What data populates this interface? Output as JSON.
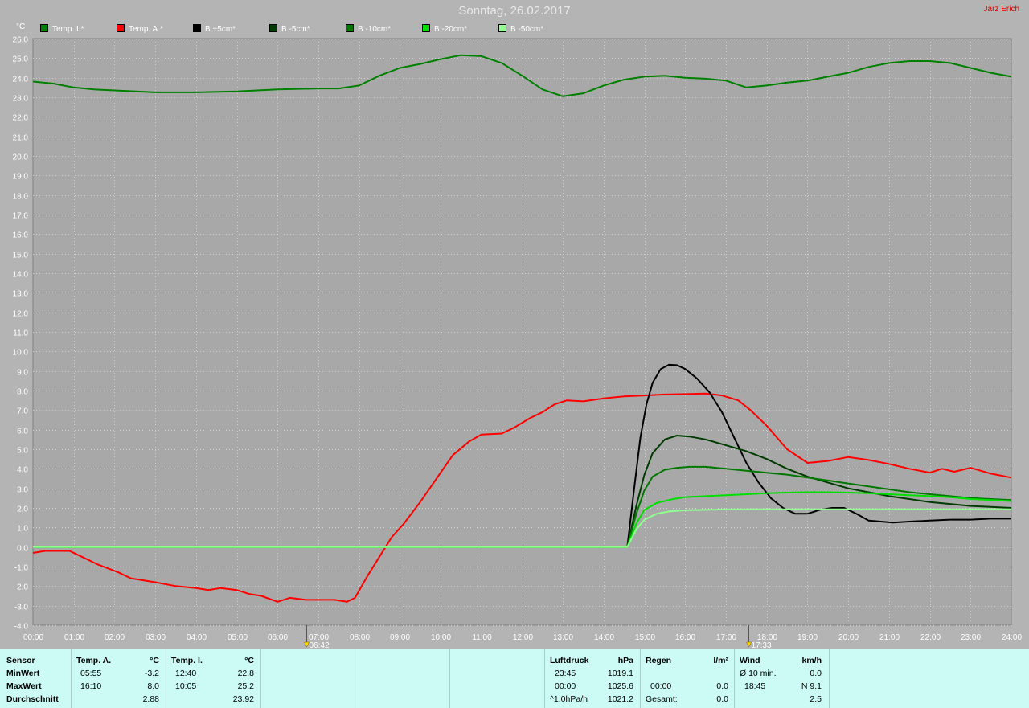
{
  "header": {
    "title": "Sonntag, 26.02.2017",
    "author": "Jarz Erich"
  },
  "legend": [
    {
      "label": "Temp. I.*",
      "color": "#008000"
    },
    {
      "label": "Temp. A.*",
      "color": "#ff0000"
    },
    {
      "label": "B +5cm*",
      "color": "#000000"
    },
    {
      "label": "B -5cm*",
      "color": "#003c00"
    },
    {
      "label": "B -10cm*",
      "color": "#007800"
    },
    {
      "label": "B -20cm*",
      "color": "#00e000"
    },
    {
      "label": "B -50cm*",
      "color": "#90ff90"
    }
  ],
  "chart_data": {
    "type": "line",
    "ylabel": "°C",
    "ylim": [
      -4,
      26
    ],
    "ystep": 1,
    "xlim": [
      0,
      24
    ],
    "xticks": [
      "00:00",
      "01:00",
      "02:00",
      "03:00",
      "04:00",
      "05:00",
      "06:00",
      "07:00",
      "08:00",
      "09:00",
      "10:00",
      "11:00",
      "12:00",
      "13:00",
      "14:00",
      "15:00",
      "16:00",
      "17:00",
      "18:00",
      "19:00",
      "20:00",
      "21:00",
      "22:00",
      "23:00",
      "24:00"
    ],
    "grid": true,
    "sun_markers": [
      {
        "label": "06:42",
        "hour": 6.7,
        "kind": "sunrise"
      },
      {
        "label": "17:33",
        "hour": 17.55,
        "kind": "sunset"
      }
    ],
    "series": [
      {
        "name": "Temp. I.*",
        "color": "#008000",
        "x": [
          0,
          0.5,
          1,
          1.5,
          2,
          3,
          4,
          5,
          6,
          7,
          7.5,
          8,
          8.5,
          9,
          9.5,
          10,
          10.5,
          11,
          11.5,
          12,
          12.5,
          13,
          13.5,
          14,
          14.5,
          15,
          15.5,
          16,
          16.5,
          17,
          17.5,
          18,
          18.5,
          19,
          19.5,
          20,
          20.5,
          21,
          21.5,
          22,
          22.5,
          23,
          23.5,
          24
        ],
        "y": [
          23.8,
          23.7,
          23.5,
          23.4,
          23.35,
          23.25,
          23.25,
          23.3,
          23.4,
          23.45,
          23.45,
          23.6,
          24.1,
          24.5,
          24.7,
          24.95,
          25.15,
          25.1,
          24.75,
          24.1,
          23.4,
          23.05,
          23.2,
          23.6,
          23.9,
          24.05,
          24.1,
          24,
          23.95,
          23.85,
          23.5,
          23.6,
          23.75,
          23.85,
          24.05,
          24.25,
          24.55,
          24.75,
          24.85,
          24.85,
          24.75,
          24.5,
          24.25,
          24.05
        ]
      },
      {
        "name": "Temp. A.*",
        "color": "#ff0000",
        "x": [
          0,
          0.3,
          0.9,
          1.2,
          1.6,
          2.1,
          2.4,
          3,
          3.5,
          4,
          4.3,
          4.6,
          5,
          5.3,
          5.6,
          6,
          6.3,
          6.7,
          7,
          7.4,
          7.7,
          7.9,
          8.2,
          8.5,
          8.8,
          9.1,
          9.5,
          9.9,
          10.3,
          10.7,
          11,
          11.5,
          11.8,
          12.2,
          12.5,
          12.8,
          13.1,
          13.5,
          14,
          14.5,
          15,
          15.5,
          16,
          16.5,
          16.9,
          17.3,
          17.6,
          18,
          18.5,
          19,
          19.5,
          20,
          20.5,
          21,
          21.5,
          22,
          22.3,
          22.6,
          23,
          23.5,
          24
        ],
        "y": [
          -0.3,
          -0.2,
          -0.2,
          -0.5,
          -0.9,
          -1.3,
          -1.6,
          -1.8,
          -2,
          -2.1,
          -2.2,
          -2.1,
          -2.2,
          -2.4,
          -2.5,
          -2.8,
          -2.6,
          -2.7,
          -2.7,
          -2.7,
          -2.8,
          -2.6,
          -1.5,
          -0.5,
          0.5,
          1.2,
          2.3,
          3.5,
          4.7,
          5.4,
          5.75,
          5.8,
          6.1,
          6.6,
          6.9,
          7.3,
          7.5,
          7.45,
          7.6,
          7.7,
          7.75,
          7.8,
          7.82,
          7.85,
          7.75,
          7.5,
          7,
          6.2,
          5.0,
          4.3,
          4.4,
          4.6,
          4.45,
          4.25,
          4.0,
          3.8,
          4.0,
          3.85,
          4.05,
          3.75,
          3.55
        ]
      },
      {
        "name": "B +5cm*",
        "color": "#000000",
        "x": [
          0,
          14.58,
          14.75,
          14.9,
          15.05,
          15.2,
          15.4,
          15.6,
          15.8,
          16,
          16.3,
          16.6,
          16.9,
          17.2,
          17.5,
          17.8,
          18.1,
          18.4,
          18.7,
          19,
          19.3,
          19.6,
          19.9,
          20.2,
          20.5,
          20.8,
          21.1,
          21.5,
          22,
          22.5,
          23,
          23.5,
          24
        ],
        "y": [
          0,
          0,
          3.0,
          5.6,
          7.3,
          8.4,
          9.1,
          9.32,
          9.3,
          9.1,
          8.6,
          7.9,
          6.9,
          5.6,
          4.3,
          3.3,
          2.5,
          2.0,
          1.7,
          1.7,
          1.9,
          2.0,
          2.0,
          1.7,
          1.35,
          1.3,
          1.25,
          1.3,
          1.35,
          1.4,
          1.4,
          1.45,
          1.45
        ]
      },
      {
        "name": "B -5cm*",
        "color": "#003c00",
        "x": [
          0,
          14.58,
          14.8,
          15,
          15.2,
          15.5,
          15.8,
          16.1,
          16.5,
          17,
          17.5,
          18,
          18.5,
          19,
          19.5,
          20,
          20.5,
          21,
          21.5,
          22,
          22.5,
          23,
          23.5,
          24
        ],
        "y": [
          0,
          0,
          2.1,
          3.7,
          4.8,
          5.5,
          5.7,
          5.65,
          5.5,
          5.2,
          4.9,
          4.5,
          4.0,
          3.6,
          3.3,
          3.0,
          2.8,
          2.6,
          2.45,
          2.3,
          2.2,
          2.1,
          2.05,
          2.0
        ]
      },
      {
        "name": "B -10cm*",
        "color": "#007800",
        "x": [
          0,
          14.58,
          14.8,
          15,
          15.2,
          15.5,
          15.8,
          16.1,
          16.5,
          17,
          17.5,
          18,
          18.5,
          19,
          19.5,
          20,
          20.5,
          21,
          21.5,
          22,
          22.5,
          23,
          23.5,
          24
        ],
        "y": [
          0,
          0,
          1.7,
          2.9,
          3.6,
          3.95,
          4.05,
          4.1,
          4.1,
          4.0,
          3.9,
          3.8,
          3.7,
          3.55,
          3.4,
          3.25,
          3.1,
          2.95,
          2.8,
          2.7,
          2.6,
          2.5,
          2.45,
          2.4
        ]
      },
      {
        "name": "B -20cm*",
        "color": "#00e000",
        "x": [
          0,
          14.58,
          14.8,
          15,
          15.3,
          15.7,
          16,
          16.5,
          17,
          17.5,
          18,
          18.5,
          19,
          19.5,
          20,
          20.5,
          21,
          21.5,
          22,
          22.5,
          23,
          23.5,
          24
        ],
        "y": [
          0,
          0,
          1.2,
          1.9,
          2.25,
          2.45,
          2.55,
          2.6,
          2.65,
          2.7,
          2.75,
          2.78,
          2.8,
          2.8,
          2.78,
          2.75,
          2.7,
          2.65,
          2.6,
          2.55,
          2.45,
          2.4,
          2.35
        ]
      },
      {
        "name": "B -50cm*",
        "color": "#90ff90",
        "x": [
          0,
          14.58,
          14.8,
          15,
          15.3,
          15.6,
          16,
          16.5,
          17,
          17.5,
          18,
          18.5,
          19,
          19.5,
          20,
          21,
          22,
          23,
          24
        ],
        "y": [
          0,
          0,
          0.9,
          1.4,
          1.7,
          1.82,
          1.88,
          1.9,
          1.92,
          1.93,
          1.93,
          1.93,
          1.93,
          1.93,
          1.93,
          1.93,
          1.93,
          1.93,
          1.93
        ]
      }
    ]
  },
  "table": {
    "sensor_header": "Sensor",
    "row_labels": [
      "MinWert",
      "MaxWert",
      "Durchschnitt"
    ],
    "temp_a": {
      "title": "Temp. A.",
      "unit": "°C",
      "min_time": "05:55",
      "min_val": "-3.2",
      "max_time": "16:10",
      "max_val": "8.0",
      "avg": "2.88"
    },
    "temp_i": {
      "title": "Temp. I.",
      "unit": "°C",
      "min_time": "12:40",
      "min_val": "22.8",
      "max_time": "10:05",
      "max_val": "25.2",
      "avg": "23.92"
    },
    "pressure": {
      "title": "Luftdruck",
      "unit": "hPa",
      "r1_time": "23:45",
      "r1_val": "1019.1",
      "r2_time": "00:00",
      "r2_val": "1025.6",
      "r3_label": "^1.0hPa/h",
      "r3_val": "1021.2"
    },
    "rain": {
      "title": "Regen",
      "unit": "l/m²",
      "r2_time": "00:00",
      "r2_val": "0.0",
      "r3_label": "Gesamt:",
      "r3_val": "0.0"
    },
    "wind": {
      "title": "Wind",
      "unit": "km/h",
      "r1_label": "Ø 10 min.",
      "r1_val": "0.0",
      "r2_time": "18:45",
      "r2_val": "N 9.1",
      "r3_val": "2.5"
    }
  }
}
